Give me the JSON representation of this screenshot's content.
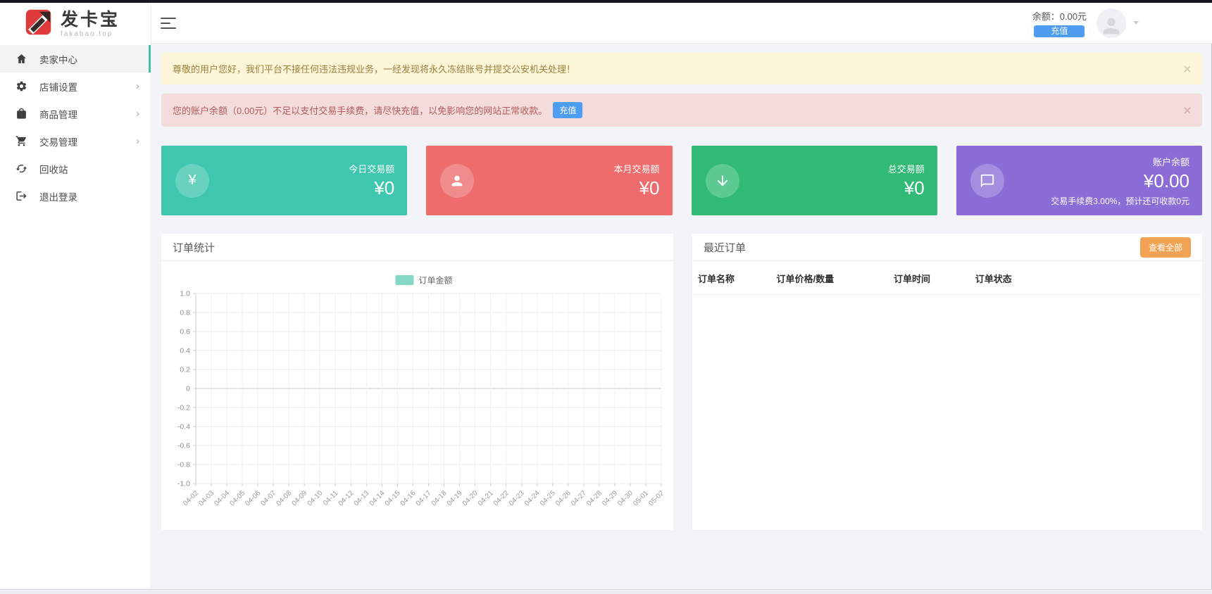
{
  "logo": {
    "title": "发卡宝",
    "domain": "fakabao.top"
  },
  "topbar": {
    "balance_text": "余额：0.00元",
    "recharge_label": "充值"
  },
  "sidebar": {
    "items": [
      {
        "label": "卖家中心",
        "icon": "home-icon",
        "active": true,
        "has_children": false
      },
      {
        "label": "店铺设置",
        "icon": "gear-icon",
        "active": false,
        "has_children": true
      },
      {
        "label": "商品管理",
        "icon": "bag-icon",
        "active": false,
        "has_children": true
      },
      {
        "label": "交易管理",
        "icon": "cart-icon",
        "active": false,
        "has_children": true
      },
      {
        "label": "回收站",
        "icon": "recycle-icon",
        "active": false,
        "has_children": false
      },
      {
        "label": "退出登录",
        "icon": "logout-icon",
        "active": false,
        "has_children": false
      }
    ],
    "chevron_glyph": "›"
  },
  "alerts": [
    {
      "type": "warning",
      "text": "尊敬的用户您好，我们平台不接任何违法违规业务，一经发现将永久冻结账号并提交公安机关处理！"
    },
    {
      "type": "danger",
      "text": "您的账户余额（0.00元）不足以支付交易手续费，请尽快充值，以免影响您的网站正常收款。",
      "action_label": "充值"
    }
  ],
  "stat_cards": [
    {
      "label": "今日交易额",
      "value": "¥0",
      "color": "#3fc6ae",
      "icon": "yen-icon",
      "icon_glyph": "¥",
      "sub": ""
    },
    {
      "label": "本月交易额",
      "value": "¥0",
      "color": "#ee6c6c",
      "icon": "person-icon",
      "sub": ""
    },
    {
      "label": "总交易额",
      "value": "¥0",
      "color": "#30ba75",
      "icon": "arrow-down-icon",
      "sub": ""
    },
    {
      "label": "账户余额",
      "value": "¥0.00",
      "color": "#8c6dd8",
      "icon": "chat-bubble-icon",
      "sub": "交易手续费3.00%，预计还可收款0元"
    }
  ],
  "order_stats_panel": {
    "title": "订单统计"
  },
  "chart_data": {
    "type": "line",
    "title": "订单统计",
    "legend": [
      "订单金额"
    ],
    "legend_color": "#86d7c5",
    "legend_position": "top",
    "grid": true,
    "ylim": [
      -1,
      1
    ],
    "y_tick_labels": [
      "1.0",
      "0.8",
      "0.6",
      "0.4",
      "0.2",
      "0",
      "-0.2",
      "-0.4",
      "-0.6",
      "-0.8",
      "-1.0"
    ],
    "x": [
      "04-02",
      "04-03",
      "04-04",
      "04-05",
      "04-06",
      "04-07",
      "04-08",
      "04-09",
      "04-10",
      "04-11",
      "04-12",
      "04-13",
      "04-14",
      "04-15",
      "04-16",
      "04-17",
      "04-18",
      "04-19",
      "04-20",
      "04-21",
      "04-22",
      "04-23",
      "04-24",
      "04-25",
      "04-26",
      "04-27",
      "04-28",
      "04-29",
      "04-30",
      "05-01",
      "05-02"
    ],
    "series": [
      {
        "name": "订单金额",
        "values": []
      }
    ]
  },
  "recent_orders_panel": {
    "title": "最近订单",
    "view_all_label": "查看全部",
    "columns": [
      "订单名称",
      "订单价格/数量",
      "订单时间",
      "订单状态"
    ],
    "rows": []
  }
}
